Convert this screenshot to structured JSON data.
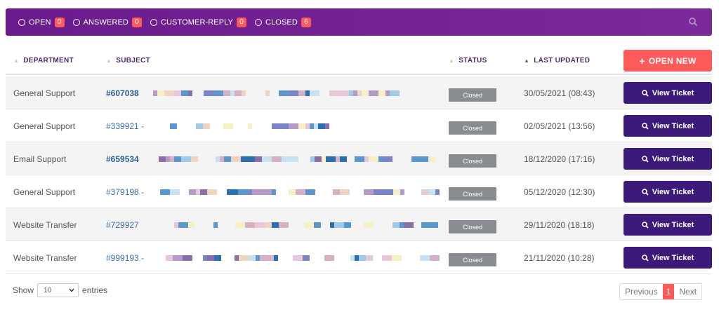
{
  "filters": [
    {
      "label": "OPEN",
      "count": "0"
    },
    {
      "label": "ANSWERED",
      "count": "0"
    },
    {
      "label": "CUSTOMER-REPLY",
      "count": "0"
    },
    {
      "label": "CLOSED",
      "count": "6"
    }
  ],
  "headers": {
    "department": "DEPARTMENT",
    "subject": "SUBJECT",
    "status": "STATUS",
    "last_updated": "LAST UPDATED"
  },
  "open_new_label": "OPEN NEW",
  "view_ticket_label": "View Ticket",
  "rows": [
    {
      "department": "General Support",
      "subject": "#607038",
      "bold": true,
      "status": "Closed",
      "updated": "30/05/2021 (08:43)"
    },
    {
      "department": "General Support",
      "subject": "#339921 -",
      "bold": false,
      "status": "Closed",
      "updated": "02/05/2021 (13:56)"
    },
    {
      "department": "Email Support",
      "subject": "#659534",
      "bold": true,
      "status": "Closed",
      "updated": "18/12/2020 (17:16)"
    },
    {
      "department": "General Support",
      "subject": "#379198 -",
      "bold": false,
      "status": "Closed",
      "updated": "05/12/2020 (12:30)"
    },
    {
      "department": "Website Transfer",
      "subject": "#729927",
      "bold": false,
      "status": "Closed",
      "updated": "29/11/2020 (18:18)"
    },
    {
      "department": "Website Transfer",
      "subject": "#999193 -",
      "bold": false,
      "status": "Closed",
      "updated": "21/11/2020 (10:28)"
    }
  ],
  "footer": {
    "show_label": "Show",
    "entries_value": "10",
    "entries_label": "entries",
    "prev": "Previous",
    "page": "1",
    "next": "Next"
  },
  "colors": {
    "bar": "#6a1b8c",
    "accent": "#ff5a5a",
    "button": "#3b1a7a",
    "status": "#888b8f"
  }
}
